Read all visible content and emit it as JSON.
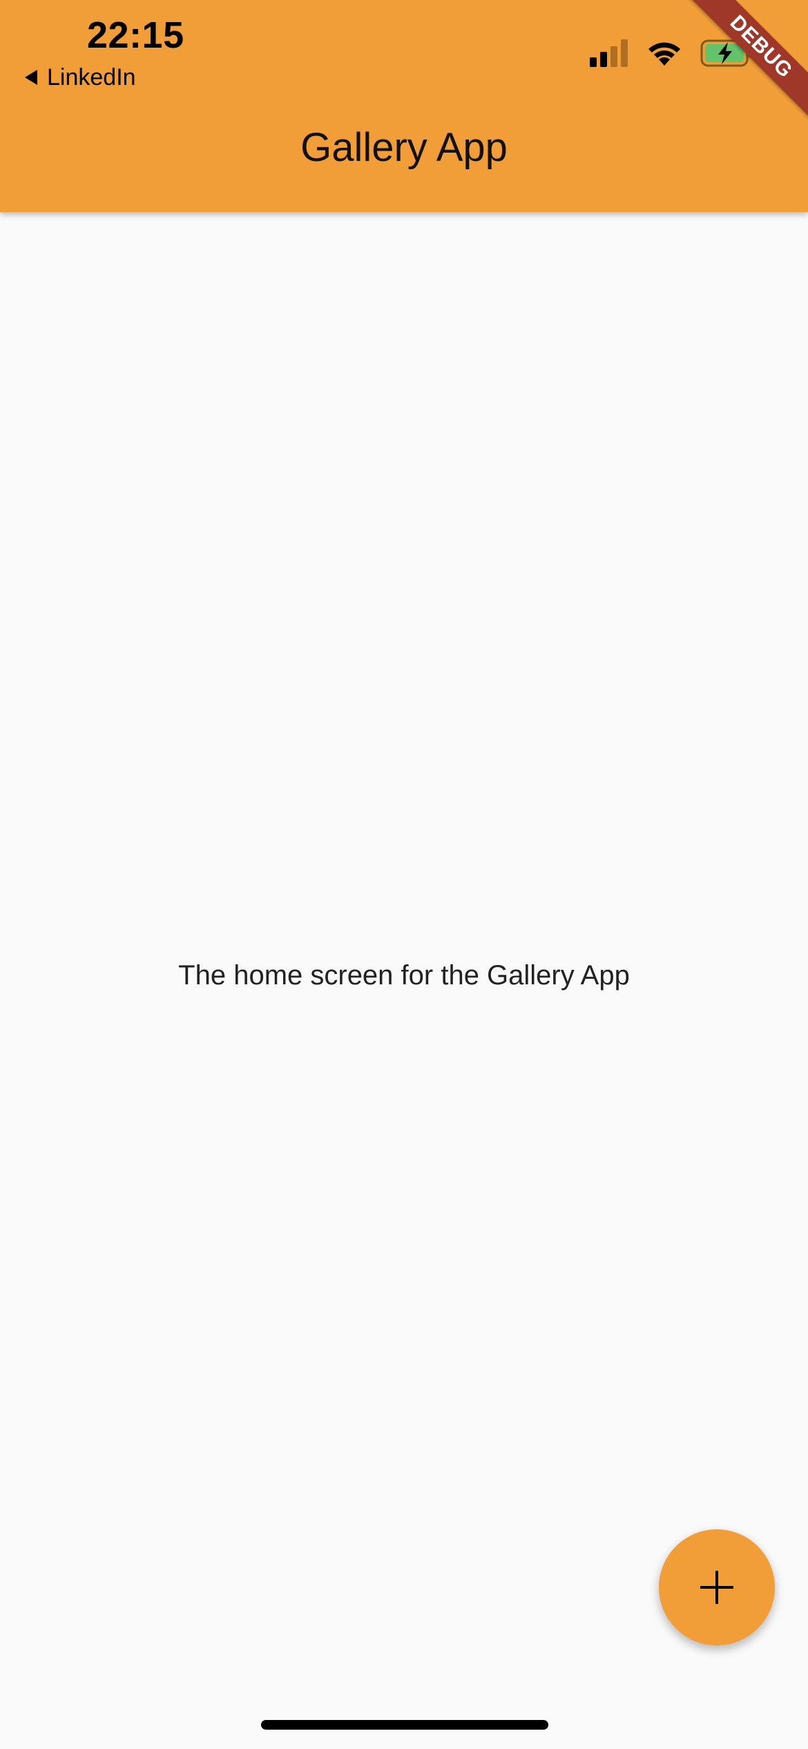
{
  "status_bar": {
    "time": "22:15",
    "back_label": "LinkedIn"
  },
  "debug_banner": "DEBUG",
  "app_bar": {
    "title": "Gallery App"
  },
  "body": {
    "text": "The home screen for the Gallery App"
  },
  "fab": {
    "icon": "plus-icon"
  },
  "colors": {
    "primary": "#f19d38",
    "background": "#fafafa",
    "debug_ribbon": "#a0382a"
  }
}
